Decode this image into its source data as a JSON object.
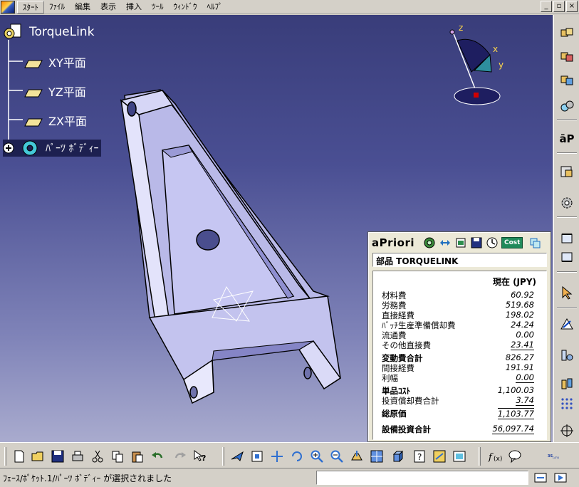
{
  "menubar": {
    "items": [
      "ｽﾀｰﾄ",
      "ﾌｧｲﾙ",
      "編集",
      "表示",
      "挿入",
      "ﾂｰﾙ",
      "ｳｨﾝﾄﾞｳ",
      "ﾍﾙﾌﾟ"
    ],
    "window_controls": [
      "_",
      "▫",
      "×"
    ]
  },
  "spec_tree": {
    "root": "TorqueLink",
    "children": [
      "XY平面",
      "YZ平面",
      "ZX平面",
      "ﾊﾟｰﾂ ﾎﾞﾃﾞｨｰ"
    ]
  },
  "compass": {
    "axes": [
      "z",
      "x",
      "y"
    ]
  },
  "apriori": {
    "logo": "aPriori",
    "cost_button": "Cost",
    "part_label": "部品 TORQUELINK",
    "column_header": "現在 (JPY)",
    "rows": [
      {
        "label": "材料費",
        "value": "60.92"
      },
      {
        "label": "労務費",
        "value": "519.68"
      },
      {
        "label": "直接経費",
        "value": "198.02"
      },
      {
        "label": "ﾊﾞｯﾁ生産準備償却費",
        "value": "24.24"
      },
      {
        "label": "流通費",
        "value": "0.00"
      },
      {
        "label": "その他直接費",
        "value": "23.41"
      },
      {
        "label": "変動費合計",
        "value": "826.27"
      },
      {
        "label": "間接経費",
        "value": "191.91"
      },
      {
        "label": "利幅",
        "value": "0.00"
      },
      {
        "label": "単品ｺｽﾄ",
        "value": "1,100.03"
      },
      {
        "label": "投資償却費合計",
        "value": "3.74"
      },
      {
        "label": "総原価",
        "value": "1,103.77"
      },
      {
        "label": "設備投資合計",
        "value": "56,097.74"
      }
    ]
  },
  "right_toolbar": {
    "icons": [
      "part-body-icon",
      "body-insert-icon",
      "body-color-icon",
      "material-icon",
      "apriori-logo-icon",
      "catalog-icon",
      "gear-icon",
      "snap-top-icon",
      "snap-bottom-icon",
      "select-arrow-icon",
      "sketch-icon",
      "measure-icon",
      "view-cube-icon",
      "grid-icon",
      "compass-icon"
    ],
    "apriori_label": "āP"
  },
  "bottom_toolbar": {
    "icons": [
      "new-icon",
      "open-icon",
      "save-icon",
      "print-icon",
      "cut-icon",
      "copy-icon",
      "paste-icon",
      "undo-icon",
      "redo-icon",
      "help-icon",
      "fly-icon",
      "fit-all-icon",
      "pan-icon",
      "rotate-icon",
      "zoom-in-icon",
      "zoom-out-icon",
      "normal-view-icon",
      "multi-view-icon",
      "iso-view-icon",
      "hide-show-icon",
      "swap-icon",
      "render-icon",
      "formula-icon",
      "comment-icon",
      "catia-logo-icon"
    ],
    "catia_label": "CATIA"
  },
  "status": {
    "message": "ﾌｪｰｽ/ﾎﾟｹｯﾄ.1/ﾊﾟｰﾂ ﾎﾞﾃﾞｨｰ が選択されました",
    "command_value": ""
  },
  "colors": {
    "viewport_top": "#393d7a",
    "viewport_bottom": "#a9abce",
    "part_face": "#c9c9ef",
    "part_dark": "#9e9edb",
    "cost_button": "#1f8a5a"
  }
}
